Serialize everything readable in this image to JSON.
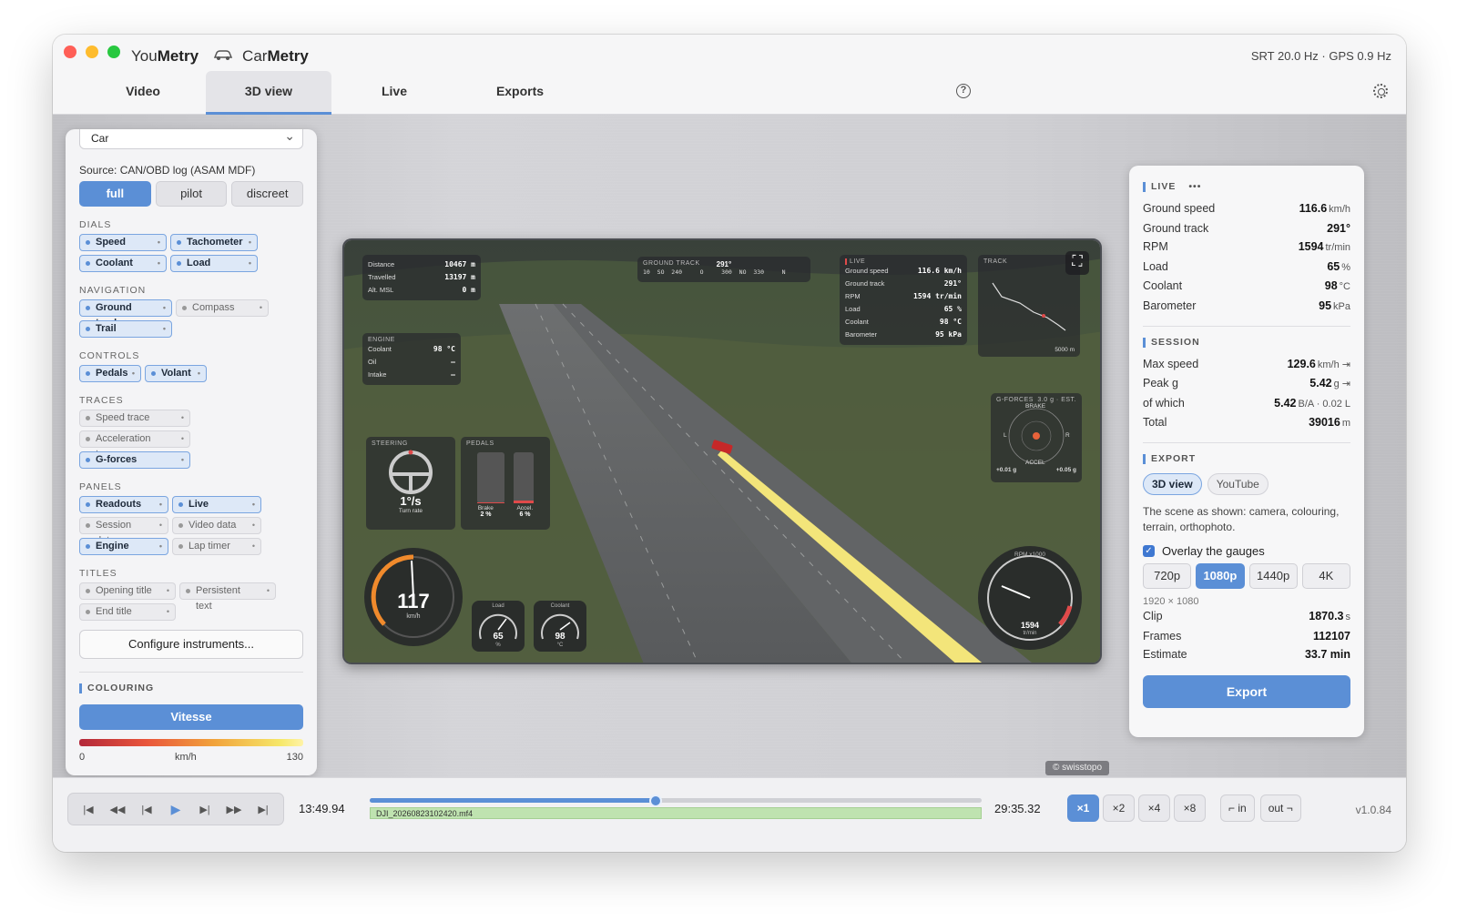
{
  "app": {
    "brand_left_a": "You",
    "brand_left_b": "Metry",
    "brand_right_a": "Car",
    "brand_right_b": "Metry",
    "rates": "SRT 20.0 Hz · GPS 0.9 Hz"
  },
  "tabs": [
    {
      "label": "Video"
    },
    {
      "label": "3D view"
    },
    {
      "label": "Live"
    },
    {
      "label": "Exports"
    }
  ],
  "left": {
    "vehicle": "Car",
    "source": "Source: CAN/OBD log (ASAM MDF)",
    "modes": [
      "full",
      "pilot",
      "discreet"
    ],
    "sections": {
      "dials": "DIALS",
      "navigation": "NAVIGATION",
      "controls": "CONTROLS",
      "traces": "TRACES",
      "panels": "PANELS",
      "titles": "TITLES"
    },
    "dials": [
      "Speed",
      "Tachometer",
      "Coolant",
      "Load"
    ],
    "navigation": [
      "Ground track",
      "Compass",
      "Trail"
    ],
    "controls": [
      "Pedals",
      "Volant"
    ],
    "traces": [
      "Speed trace",
      "Acceleration trace",
      "G-forces"
    ],
    "panels": [
      "Readouts",
      "Live",
      "Session data",
      "Video data",
      "Engine",
      "Lap timer"
    ],
    "titles": [
      "Opening title",
      "Persistent text",
      "End title"
    ],
    "configure": "Configure instruments...",
    "colouring": "COLOURING",
    "colour_mode": "Vitesse",
    "scale_min": "0",
    "scale_unit": "km/h",
    "scale_max": "130"
  },
  "hud": {
    "dist": {
      "l1": "Distance",
      "v1": "10467 m",
      "l2": "Travelled",
      "v2": "13197 m",
      "l3": "Alt. MSL",
      "v3": "0 m"
    },
    "engine": {
      "title": "ENGINE",
      "l1": "Coolant",
      "v1": "98 °C",
      "l2": "Oil",
      "v2": "—",
      "l3": "Intake",
      "v3": "—"
    },
    "compass": {
      "title": "GROUND TRACK",
      "value": "291°",
      "marks": "10  SO  240     O     300  NO  330     N"
    },
    "live": {
      "title": "LIVE",
      "r1": "Ground speed",
      "v1": "116.6 km/h",
      "r2": "Ground track",
      "v2": "291°",
      "r3": "RPM",
      "v3": "1594 tr/min",
      "r4": "Load",
      "v4": "65 %",
      "r5": "Coolant",
      "v5": "98 °C",
      "r6": "Barometer",
      "v6": "95 kPa"
    },
    "track": {
      "title": "TRACK",
      "scale": "5000 m"
    },
    "gforces": {
      "title": "G-FORCES",
      "info": "3.0 g · EST.",
      "brake": "BRAKE",
      "accel": "ACCEL",
      "left": "L",
      "right": "R",
      "vl": "+0.01 g",
      "vr": "+0.05 g"
    },
    "steering": {
      "title": "STEERING",
      "value": "1°/s",
      "sub": "Turn rate"
    },
    "pedals": {
      "title": "PEDALS",
      "brake": "Brake",
      "brake_v": "2 %",
      "accel": "Accel.",
      "accel_v": "6 %"
    },
    "speed": {
      "value": "117",
      "unit": "km/h"
    },
    "load": {
      "label": "Load",
      "value": "65",
      "unit": "%"
    },
    "coolant": {
      "label": "Coolant",
      "value": "98",
      "unit": "°C"
    },
    "rpm": {
      "label": "RPM x1000",
      "value": "1594",
      "unit": "tr/min"
    }
  },
  "attribution": "© swisstopo",
  "right": {
    "live_title": "LIVE",
    "live": [
      {
        "label": "Ground speed",
        "value": "116.6",
        "unit": "km/h"
      },
      {
        "label": "Ground track",
        "value": "291°",
        "unit": ""
      },
      {
        "label": "RPM",
        "value": "1594",
        "unit": "tr/min"
      },
      {
        "label": "Load",
        "value": "65",
        "unit": "%"
      },
      {
        "label": "Coolant",
        "value": "98",
        "unit": "°C"
      },
      {
        "label": "Barometer",
        "value": "95",
        "unit": "kPa"
      }
    ],
    "session_title": "SESSION",
    "session": [
      {
        "label": "Max speed",
        "value": "129.6",
        "unit": "km/h ⇥"
      },
      {
        "label": "Peak g",
        "value": "5.42",
        "unit": "g ⇥"
      },
      {
        "label": "of which",
        "value": "5.42",
        "unit": "B/A · 0.02 L"
      },
      {
        "label": "Total",
        "value": "39016",
        "unit": "m"
      }
    ],
    "export_title": "EXPORT",
    "export_modes": [
      "3D view",
      "YouTube"
    ],
    "export_desc": "The scene as shown: camera, colouring, terrain, orthophoto.",
    "overlay_label": "Overlay the gauges",
    "resolutions": [
      "720p",
      "1080p",
      "1440p",
      "4K"
    ],
    "dims": "1920 × 1080",
    "stats": [
      {
        "label": "Clip",
        "value": "1870.3",
        "unit": "s"
      },
      {
        "label": "Frames",
        "value": "112107",
        "unit": ""
      },
      {
        "label": "Estimate",
        "value": "33.7 min",
        "unit": ""
      }
    ],
    "export_button": "Export"
  },
  "bottom": {
    "current_time": "13:49.94",
    "total_time": "29:35.32",
    "progress": 0.467,
    "file": "DJI_20260823102420.mf4",
    "speeds": [
      "×1",
      "×2",
      "×4",
      "×8"
    ],
    "mark_in": "⌐ in",
    "mark_out": "out ¬",
    "version": "v1.0.84"
  }
}
